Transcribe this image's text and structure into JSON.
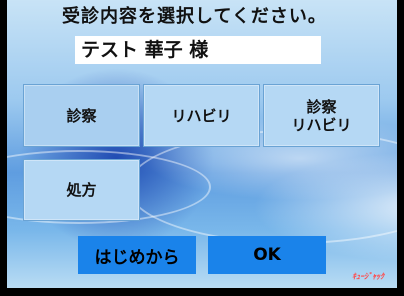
{
  "header": {
    "title": "受診内容を選択してください。"
  },
  "patient": {
    "name": "テスト 華子 様"
  },
  "options": [
    {
      "line1": "診察",
      "line2": ""
    },
    {
      "line1": "リハビリ",
      "line2": ""
    },
    {
      "line1": "診察",
      "line2": "リハビリ"
    },
    {
      "line1": "処方",
      "line2": ""
    }
  ],
  "actions": {
    "restart_label": "はじめから",
    "ok_label": "OK"
  },
  "brand": {
    "logo": "ｷｭｰｼﾞｬｯｸ"
  },
  "colors": {
    "option_bg": "#b5d8f4",
    "action_bg": "#1a83ea",
    "logo": "#ff4a4a"
  }
}
